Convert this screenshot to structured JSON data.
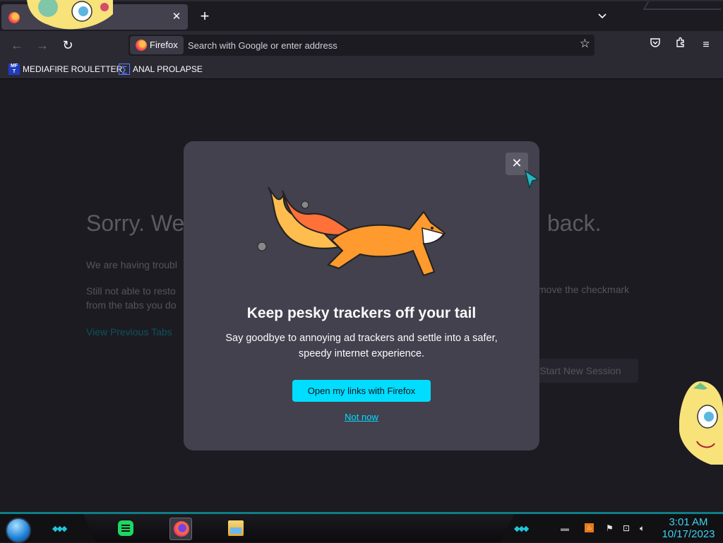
{
  "browser": {
    "tab": {
      "close_glyph": "✕"
    },
    "newtab_glyph": "+",
    "tablist_glyph": "⌄",
    "nav": {
      "back": "←",
      "forward": "→",
      "reload": "↻"
    },
    "identity_label": "Firefox",
    "url_placeholder": "Search with Google or enter address",
    "icons": {
      "pocket": "pocket-icon",
      "extensions": "extensions-icon",
      "menu": "≡"
    },
    "bookmarks": [
      {
        "label": "MEDIAFIRE ROULETTER",
        "icon_text": "MF T"
      },
      {
        "label": "ANAL PROLAPSE",
        "icon_text": "∑"
      }
    ]
  },
  "error_page": {
    "title_left": "Sorry. We’",
    "title_right": "back.",
    "line1": "We are having troubl",
    "line2a": "Still not able to resto",
    "line2b": "from the tabs you do",
    "line2_right": "move the checkmark",
    "view_tabs": "View Previous Tabs",
    "new_session": "Start New Session"
  },
  "modal": {
    "close_glyph": "✕",
    "title": "Keep pesky trackers off your tail",
    "text_line1": "Say goodbye to annoying ad trackers and settle into a safer,",
    "text_line2": "speedy internet experience.",
    "primary_button": "Open my links with Firefox",
    "secondary_link": "Not now"
  },
  "taskbar": {
    "time": "3:01 AM",
    "date": "10/17/2023",
    "chevrons": "◆◆◆"
  },
  "colors": {
    "accent_cyan": "#00ddff",
    "browser_bg": "#1c1b22",
    "toolbar_bg": "#2b2a33",
    "modal_bg": "#42414d"
  }
}
